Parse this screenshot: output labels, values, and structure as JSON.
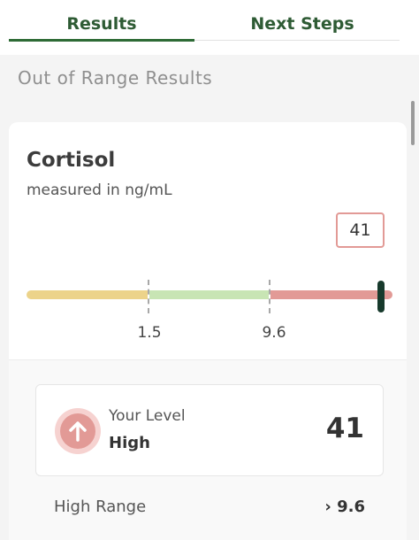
{
  "tabs": [
    {
      "label": "Results",
      "active": true
    },
    {
      "label": "Next Steps",
      "active": false
    }
  ],
  "section_heading": "Out of Range Results",
  "result": {
    "test_name": "Cortisol",
    "unit_text": "measured in ng/mL",
    "value": "41",
    "range_thresholds": [
      "1.5",
      "9.6"
    ],
    "level_label": "Your Level",
    "level_status": "High",
    "level_value": "41",
    "range_row_label": "High Range",
    "range_row_value": "› 9.6"
  },
  "icons": {
    "level": "arrow-up-icon"
  },
  "colors": {
    "brand_green": "#2e5b34",
    "low_range": "#ecd38a",
    "normal_range": "#c8e5b4",
    "high_range": "#e29a96",
    "marker": "#173a2c"
  }
}
